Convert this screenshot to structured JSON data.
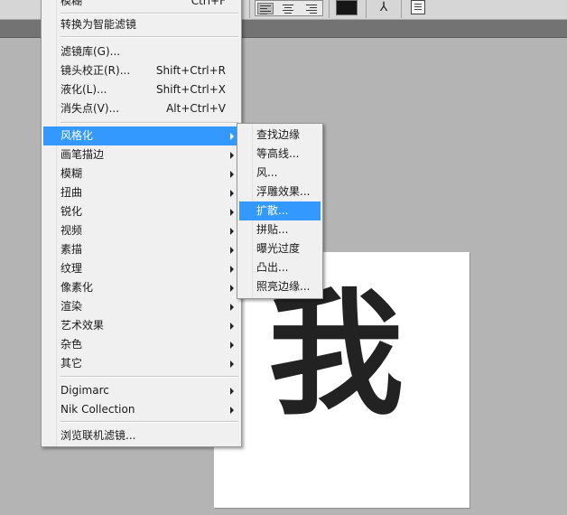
{
  "menu": {
    "partial_top_label": "模糊",
    "partial_top_shortcut": "Ctrl+F",
    "items": [
      {
        "label": "转换为智能滤镜",
        "shortcut": ""
      },
      {
        "label": "滤镜库(G)...",
        "shortcut": ""
      },
      {
        "label": "镜头校正(R)...",
        "shortcut": "Shift+Ctrl+R"
      },
      {
        "label": "液化(L)...",
        "shortcut": "Shift+Ctrl+X"
      },
      {
        "label": "消失点(V)...",
        "shortcut": "Alt+Ctrl+V"
      },
      {
        "label": "风格化",
        "highlighted": true
      },
      {
        "label": "画笔描边"
      },
      {
        "label": "模糊"
      },
      {
        "label": "扭曲"
      },
      {
        "label": "锐化"
      },
      {
        "label": "视频"
      },
      {
        "label": "素描"
      },
      {
        "label": "纹理"
      },
      {
        "label": "像素化"
      },
      {
        "label": "渲染"
      },
      {
        "label": "艺术效果"
      },
      {
        "label": "杂色"
      },
      {
        "label": "其它"
      },
      {
        "label": "Digimarc"
      },
      {
        "label": "Nik Collection"
      },
      {
        "label": "浏览联机滤镜..."
      }
    ]
  },
  "submenu": {
    "items": [
      {
        "label": "查找边缘"
      },
      {
        "label": "等高线..."
      },
      {
        "label": "风..."
      },
      {
        "label": "浮雕效果..."
      },
      {
        "label": "扩散...",
        "highlighted": true
      },
      {
        "label": "拼贴..."
      },
      {
        "label": "曝光过度"
      },
      {
        "label": "凸出..."
      },
      {
        "label": "照亮边缘..."
      }
    ]
  },
  "canvas": {
    "glyph": "我",
    "glyph_color": "#222222",
    "background": "#ffffff"
  },
  "colors": {
    "highlight": "#3399ff",
    "menu_bg": "#f0f0f0",
    "workspace": "#b4b4b4",
    "foreground_swatch": "#161616"
  },
  "toolbar": {
    "icons": [
      "align-left-icon",
      "align-center-icon",
      "align-right-icon",
      "color-swatch",
      "warp-text-icon",
      "panels-icon"
    ],
    "warp_glyph": "⅄"
  }
}
